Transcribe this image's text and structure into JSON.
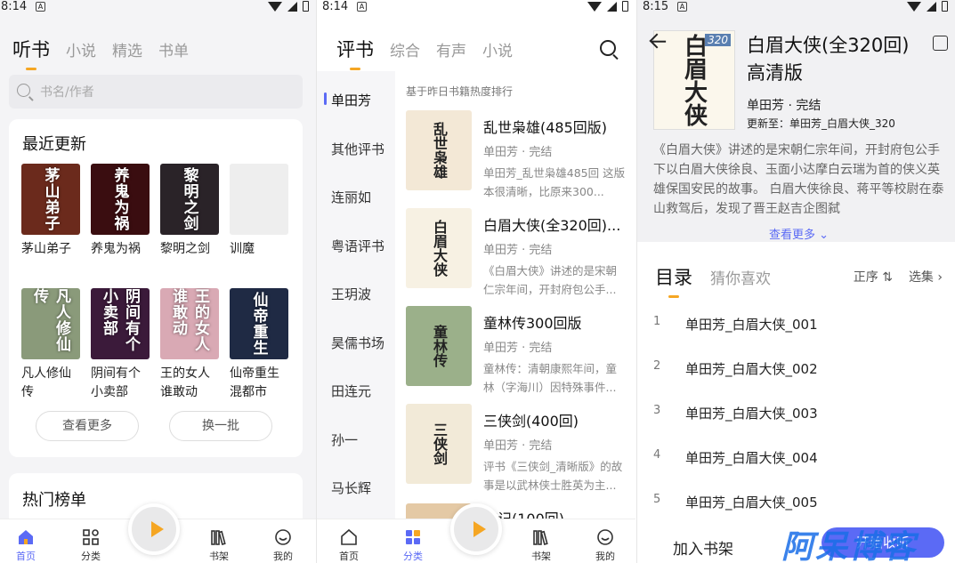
{
  "panel1": {
    "status_time": "8:14",
    "tabs": [
      "听书",
      "小说",
      "精选",
      "书单"
    ],
    "search_placeholder": "书名/作者",
    "recent_title": "最近更新",
    "books": [
      {
        "title": "茅山弟子",
        "cover_text": "茅山弟子",
        "color": "#6b2a1c"
      },
      {
        "title": "养鬼为祸",
        "cover_text": "养鬼为祸",
        "color": "#3a0d10"
      },
      {
        "title": "黎明之剑",
        "cover_text": "黎明之剑",
        "color": "#2a2328"
      },
      {
        "title": "训魔",
        "cover_text": "",
        "color": "#eeeeee"
      },
      {
        "title": "凡人修仙传",
        "cover_text": "凡人修仙传",
        "color": "#8a9a7a"
      },
      {
        "title": "阴间有个小卖部",
        "cover_text": "阴间有个小卖部",
        "color": "#3b1a3a"
      },
      {
        "title": "王的女人谁敢动",
        "cover_text": "王的女人谁敢动",
        "color": "#d9a9b4"
      },
      {
        "title": "仙帝重生混都市",
        "cover_text": "仙帝重生",
        "color": "#1f2a44"
      }
    ],
    "more_btn": "查看更多",
    "swap_btn": "换一批",
    "hot_title": "热门榜单",
    "nav": [
      "首页",
      "分类",
      "书架",
      "我的"
    ]
  },
  "panel2": {
    "status_time": "8:14",
    "tabs": [
      "评书",
      "综合",
      "有声",
      "小说"
    ],
    "categories": [
      "单田芳",
      "其他评书",
      "连丽如",
      "粤语评书",
      "王玥波",
      "昊儒书场",
      "田连元",
      "孙一",
      "马长辉"
    ],
    "rank_header": "基于昨日书籍热度排行",
    "items": [
      {
        "title": "乱世枭雄(485回版)",
        "author": "单田芳 · 完结",
        "desc": "单田芳_乱世枭雄485回 这版本很清晰，比原来300...",
        "cover_text": "乱世枭雄",
        "color": "#f3e8d6"
      },
      {
        "title": "白眉大侠(全320回)...",
        "author": "单田芳 · 完结",
        "desc": "《白眉大侠》讲述的是宋朝仁宗年间，开封府包公手...",
        "cover_text": "白眉大侠",
        "color": "#f7f1e3"
      },
      {
        "title": "童林传300回版",
        "author": "单田芳 · 完结",
        "desc": "童林传：清朝康熙年间，童林（字海川）因特殊事件...",
        "cover_text": "童林传",
        "color": "#9bb08a"
      },
      {
        "title": "三侠剑(400回)",
        "author": "单田芳 · 完结",
        "desc": "评书《三侠剑_清晰版》的故事是以武林侠士胜英为主...",
        "cover_text": "三侠剑",
        "color": "#f2ead8"
      }
    ],
    "partial_title": "游记(100回)",
    "nav": [
      "首页",
      "分类",
      "书架",
      "我的"
    ]
  },
  "panel3": {
    "status_time": "8:15",
    "title": "白眉大侠(全320回)高清版",
    "cover_text": "白眉大侠",
    "cover_badge": "320",
    "author": "单田芳 · 完结",
    "update": "更新至：单田芳_白眉大侠_320",
    "desc": "《白眉大侠》讲述的是宋朝仁宗年间，开封府包公手下以白眉大侠徐良、玉面小达摩白云瑞为首的侠义英雄保国安民的故事。 白眉大侠徐良、蒋平等校尉在泰山救驾后，发现了晋王赵吉企图弑",
    "more": "查看更多",
    "tabs": [
      "目录",
      "猜你喜欢"
    ],
    "order": "正序",
    "select": "选集",
    "chapters": [
      {
        "no": "1",
        "name": "单田芳_白眉大侠_001"
      },
      {
        "no": "2",
        "name": "单田芳_白眉大侠_002"
      },
      {
        "no": "3",
        "name": "单田芳_白眉大侠_003"
      },
      {
        "no": "4",
        "name": "单田芳_白眉大侠_004"
      },
      {
        "no": "5",
        "name": "单田芳_白眉大侠_005"
      }
    ],
    "add_shelf": "加入书架",
    "listen": "开始收听",
    "watermark": "阿呆博客"
  }
}
